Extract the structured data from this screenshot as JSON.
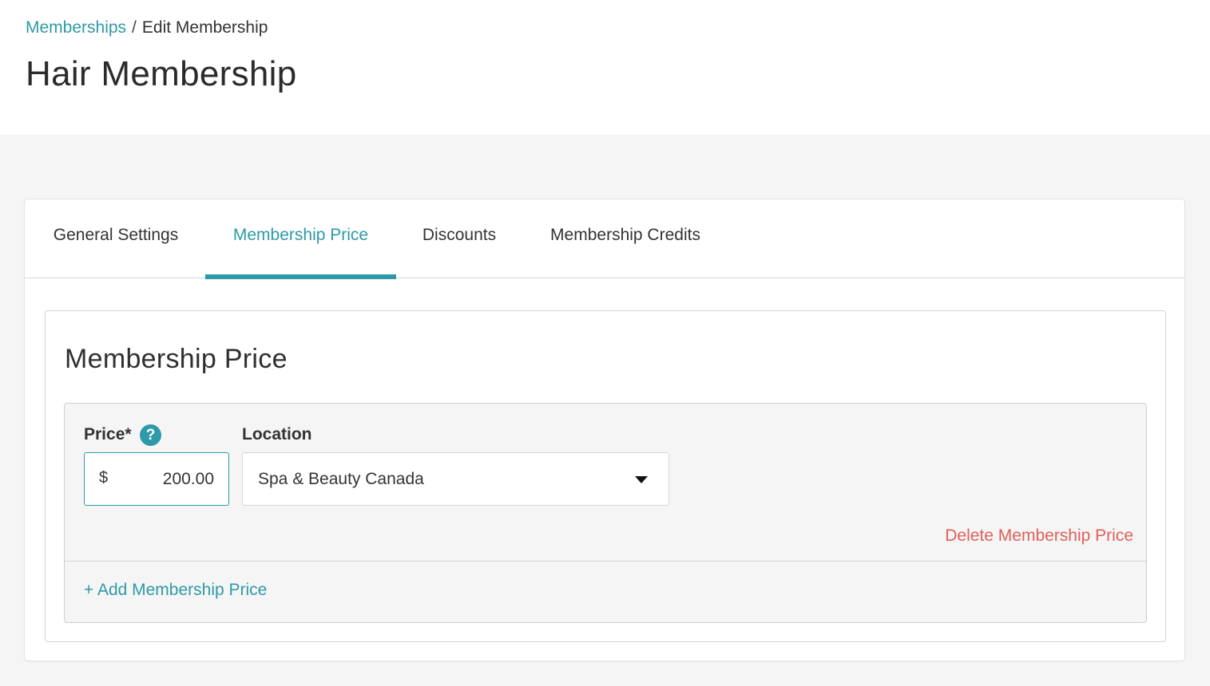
{
  "breadcrumb": {
    "parent": "Memberships",
    "separator": "/",
    "current": "Edit Membership"
  },
  "page": {
    "title": "Hair Membership"
  },
  "tabs": [
    {
      "label": "General Settings",
      "active": false
    },
    {
      "label": "Membership Price",
      "active": true
    },
    {
      "label": "Discounts",
      "active": false
    },
    {
      "label": "Membership Credits",
      "active": false
    }
  ],
  "section": {
    "title": "Membership Price"
  },
  "price_entry": {
    "price_label": "Price*",
    "help_icon": "question-icon",
    "help_glyph": "?",
    "currency_symbol": "$",
    "price_value": "200.00",
    "location_label": "Location",
    "location_value": "Spa & Beauty Canada",
    "delete_label": "Delete Membership Price"
  },
  "add_label": "+ Add Membership Price",
  "colors": {
    "accent": "#2e9aa8",
    "danger": "#e0605a",
    "page_bg": "#f5f5f5"
  }
}
